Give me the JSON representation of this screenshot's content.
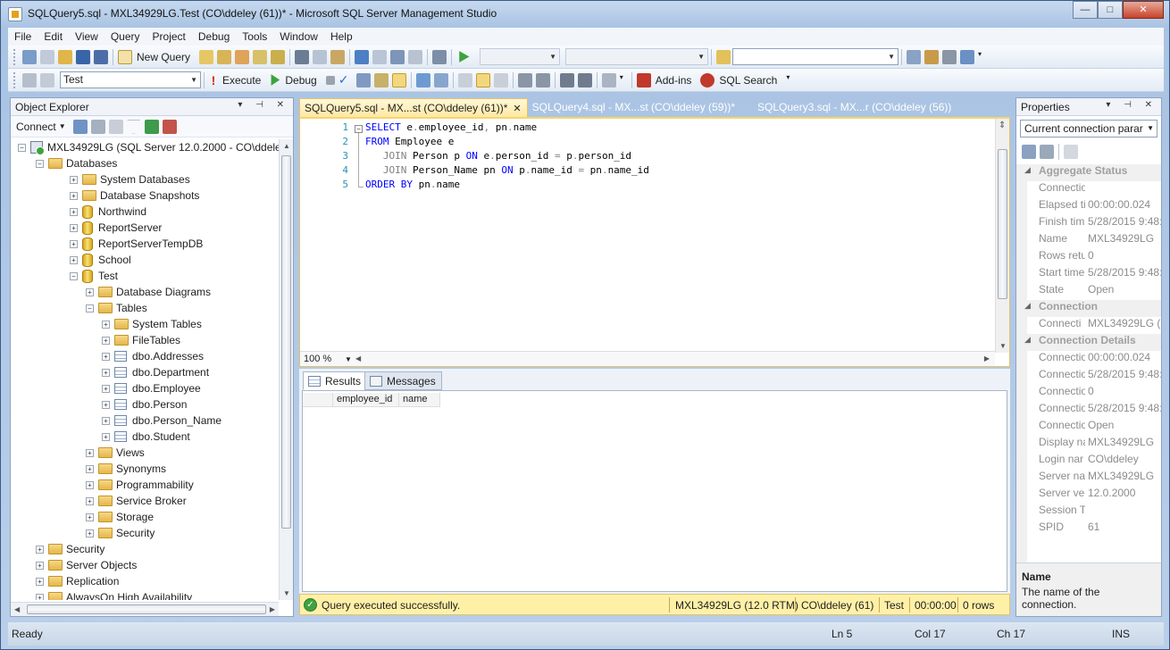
{
  "window": {
    "title": "SQLQuery5.sql - MXL34929LG.Test (CO\\ddeley (61))* - Microsoft SQL Server Management Studio",
    "controls": {
      "minimize": "—",
      "maximize": "□",
      "close": "✕"
    }
  },
  "menu": [
    "File",
    "Edit",
    "View",
    "Query",
    "Project",
    "Debug",
    "Tools",
    "Window",
    "Help"
  ],
  "toolbar1": {
    "new_query_label": "New Query",
    "combo1": "",
    "combo2": "",
    "search_combo": ""
  },
  "toolbar2": {
    "database": "Test",
    "execute_label": "Execute",
    "debug_label": "Debug",
    "addins_label": "Add-ins",
    "sqlsearch_label": "SQL Search"
  },
  "object_explorer": {
    "title": "Object Explorer",
    "connect_label": "Connect",
    "tree": [
      {
        "label": "MXL34929LG (SQL Server 12.0.2000 - CO\\ddeley)",
        "depth": 0,
        "expander": "−",
        "icon": "server-icon"
      },
      {
        "label": "Databases",
        "depth": 1,
        "expander": "−",
        "icon": "folder-icon"
      },
      {
        "label": "System Databases",
        "depth": 2,
        "expander": "+",
        "icon": "folder-icon"
      },
      {
        "label": "Database Snapshots",
        "depth": 2,
        "expander": "+",
        "icon": "folder-icon"
      },
      {
        "label": "Northwind",
        "depth": 2,
        "expander": "+",
        "icon": "database-icon"
      },
      {
        "label": "ReportServer",
        "depth": 2,
        "expander": "+",
        "icon": "database-icon"
      },
      {
        "label": "ReportServerTempDB",
        "depth": 2,
        "expander": "+",
        "icon": "database-icon"
      },
      {
        "label": "School",
        "depth": 2,
        "expander": "+",
        "icon": "database-icon"
      },
      {
        "label": "Test",
        "depth": 2,
        "expander": "−",
        "icon": "database-icon"
      },
      {
        "label": "Database Diagrams",
        "depth": 3,
        "expander": "+",
        "icon": "folder-icon"
      },
      {
        "label": "Tables",
        "depth": 3,
        "expander": "−",
        "icon": "folder-icon"
      },
      {
        "label": "System Tables",
        "depth": 4,
        "expander": "+",
        "icon": "folder-icon"
      },
      {
        "label": "FileTables",
        "depth": 4,
        "expander": "+",
        "icon": "folder-icon"
      },
      {
        "label": "dbo.Addresses",
        "depth": 4,
        "expander": "+",
        "icon": "table-icon"
      },
      {
        "label": "dbo.Department",
        "depth": 4,
        "expander": "+",
        "icon": "table-icon"
      },
      {
        "label": "dbo.Employee",
        "depth": 4,
        "expander": "+",
        "icon": "table-icon"
      },
      {
        "label": "dbo.Person",
        "depth": 4,
        "expander": "+",
        "icon": "table-icon"
      },
      {
        "label": "dbo.Person_Name",
        "depth": 4,
        "expander": "+",
        "icon": "table-icon"
      },
      {
        "label": "dbo.Student",
        "depth": 4,
        "expander": "+",
        "icon": "table-icon"
      },
      {
        "label": "Views",
        "depth": 3,
        "expander": "+",
        "icon": "folder-icon"
      },
      {
        "label": "Synonyms",
        "depth": 3,
        "expander": "+",
        "icon": "folder-icon"
      },
      {
        "label": "Programmability",
        "depth": 3,
        "expander": "+",
        "icon": "folder-icon"
      },
      {
        "label": "Service Broker",
        "depth": 3,
        "expander": "+",
        "icon": "folder-icon"
      },
      {
        "label": "Storage",
        "depth": 3,
        "expander": "+",
        "icon": "folder-icon"
      },
      {
        "label": "Security",
        "depth": 3,
        "expander": "+",
        "icon": "folder-icon"
      },
      {
        "label": "Security",
        "depth": 1,
        "expander": "+",
        "icon": "folder-icon"
      },
      {
        "label": "Server Objects",
        "depth": 1,
        "expander": "+",
        "icon": "folder-icon"
      },
      {
        "label": "Replication",
        "depth": 1,
        "expander": "+",
        "icon": "folder-icon"
      },
      {
        "label": "AlwaysOn High Availability",
        "depth": 1,
        "expander": "+",
        "icon": "folder-icon"
      }
    ]
  },
  "tabs": [
    {
      "label": "SQLQuery5.sql - MX...st (CO\\ddeley (61))*",
      "active": true
    },
    {
      "label": "SQLQuery4.sql - MX...st (CO\\ddeley (59))*",
      "active": false
    },
    {
      "label": "SQLQuery3.sql - MX...r (CO\\ddeley (56))",
      "active": false
    }
  ],
  "editor": {
    "lines": [
      [
        {
          "t": "SELECT",
          "k": "kw"
        },
        {
          "t": " e",
          "k": ""
        },
        {
          "t": ".",
          "k": "op"
        },
        {
          "t": "employee_id",
          "k": ""
        },
        {
          "t": ",",
          "k": "op"
        },
        {
          "t": " pn",
          "k": ""
        },
        {
          "t": ".",
          "k": "op"
        },
        {
          "t": "name",
          "k": ""
        }
      ],
      [
        {
          "t": "FROM",
          "k": "kw"
        },
        {
          "t": " Employee e",
          "k": ""
        }
      ],
      [
        {
          "t": "   JOIN",
          "k": "op"
        },
        {
          "t": " Person p ",
          "k": ""
        },
        {
          "t": "ON",
          "k": "kw"
        },
        {
          "t": " e",
          "k": ""
        },
        {
          "t": ".",
          "k": "op"
        },
        {
          "t": "person_id ",
          "k": ""
        },
        {
          "t": "=",
          "k": "op"
        },
        {
          "t": " p",
          "k": ""
        },
        {
          "t": ".",
          "k": "op"
        },
        {
          "t": "person_id",
          "k": ""
        }
      ],
      [
        {
          "t": "   JOIN",
          "k": "op"
        },
        {
          "t": " Person_Name pn ",
          "k": ""
        },
        {
          "t": "ON",
          "k": "kw"
        },
        {
          "t": " p",
          "k": ""
        },
        {
          "t": ".",
          "k": "op"
        },
        {
          "t": "name_id ",
          "k": ""
        },
        {
          "t": "=",
          "k": "op"
        },
        {
          "t": " pn",
          "k": ""
        },
        {
          "t": ".",
          "k": "op"
        },
        {
          "t": "name_id",
          "k": ""
        }
      ],
      [
        {
          "t": "ORDER BY",
          "k": "kw"
        },
        {
          "t": " pn",
          "k": ""
        },
        {
          "t": ".",
          "k": "op"
        },
        {
          "t": "name",
          "k": ""
        }
      ]
    ],
    "line_numbers": [
      "1",
      "2",
      "3",
      "4",
      "5"
    ],
    "zoom": "100 %"
  },
  "results": {
    "tab_results": "Results",
    "tab_messages": "Messages",
    "columns": [
      "employee_id",
      "name"
    ]
  },
  "query_status": {
    "message": "Query executed successfully.",
    "server": "MXL34929LG (12.0 RTM)",
    "user": "CO\\ddeley (61)",
    "database": "Test",
    "elapsed": "00:00:00",
    "rows": "0 rows"
  },
  "properties": {
    "title": "Properties",
    "selector": "Current connection parar",
    "rows": [
      {
        "type": "cat",
        "name": "Aggregate Status",
        "value": ""
      },
      {
        "type": "prop",
        "name": "Connectio",
        "value": ""
      },
      {
        "type": "prop",
        "name": "Elapsed ti",
        "value": "00:00:00.024"
      },
      {
        "type": "prop",
        "name": "Finish tim",
        "value": "5/28/2015 9:48:"
      },
      {
        "type": "prop",
        "name": "Name",
        "value": "MXL34929LG"
      },
      {
        "type": "prop",
        "name": "Rows retu",
        "value": "0"
      },
      {
        "type": "prop",
        "name": "Start time",
        "value": "5/28/2015 9:48:"
      },
      {
        "type": "prop",
        "name": "State",
        "value": "Open"
      },
      {
        "type": "cat",
        "name": "Connection",
        "value": ""
      },
      {
        "type": "prop",
        "name": "Connecti",
        "value": "MXL34929LG (("
      },
      {
        "type": "cat",
        "name": "Connection Details",
        "value": ""
      },
      {
        "type": "prop",
        "name": "Connectio",
        "value": "00:00:00.024"
      },
      {
        "type": "prop",
        "name": "Connectio",
        "value": "5/28/2015 9:48:"
      },
      {
        "type": "prop",
        "name": "Connectio",
        "value": "0"
      },
      {
        "type": "prop",
        "name": "Connectio",
        "value": "5/28/2015 9:48:"
      },
      {
        "type": "prop",
        "name": "Connectio",
        "value": "Open"
      },
      {
        "type": "prop",
        "name": "Display na",
        "value": "MXL34929LG"
      },
      {
        "type": "prop",
        "name": "Login nar",
        "value": "CO\\ddeley"
      },
      {
        "type": "prop",
        "name": "Server nar",
        "value": "MXL34929LG"
      },
      {
        "type": "prop",
        "name": "Server ver",
        "value": "12.0.2000"
      },
      {
        "type": "prop",
        "name": "Session T",
        "value": ""
      },
      {
        "type": "prop",
        "name": "SPID",
        "value": "61"
      }
    ],
    "desc_title": "Name",
    "desc_text": "The name of the connection."
  },
  "statusbar": {
    "ready": "Ready",
    "ln": "Ln 5",
    "col": "Col 17",
    "ch": "Ch 17",
    "ins": "INS"
  }
}
